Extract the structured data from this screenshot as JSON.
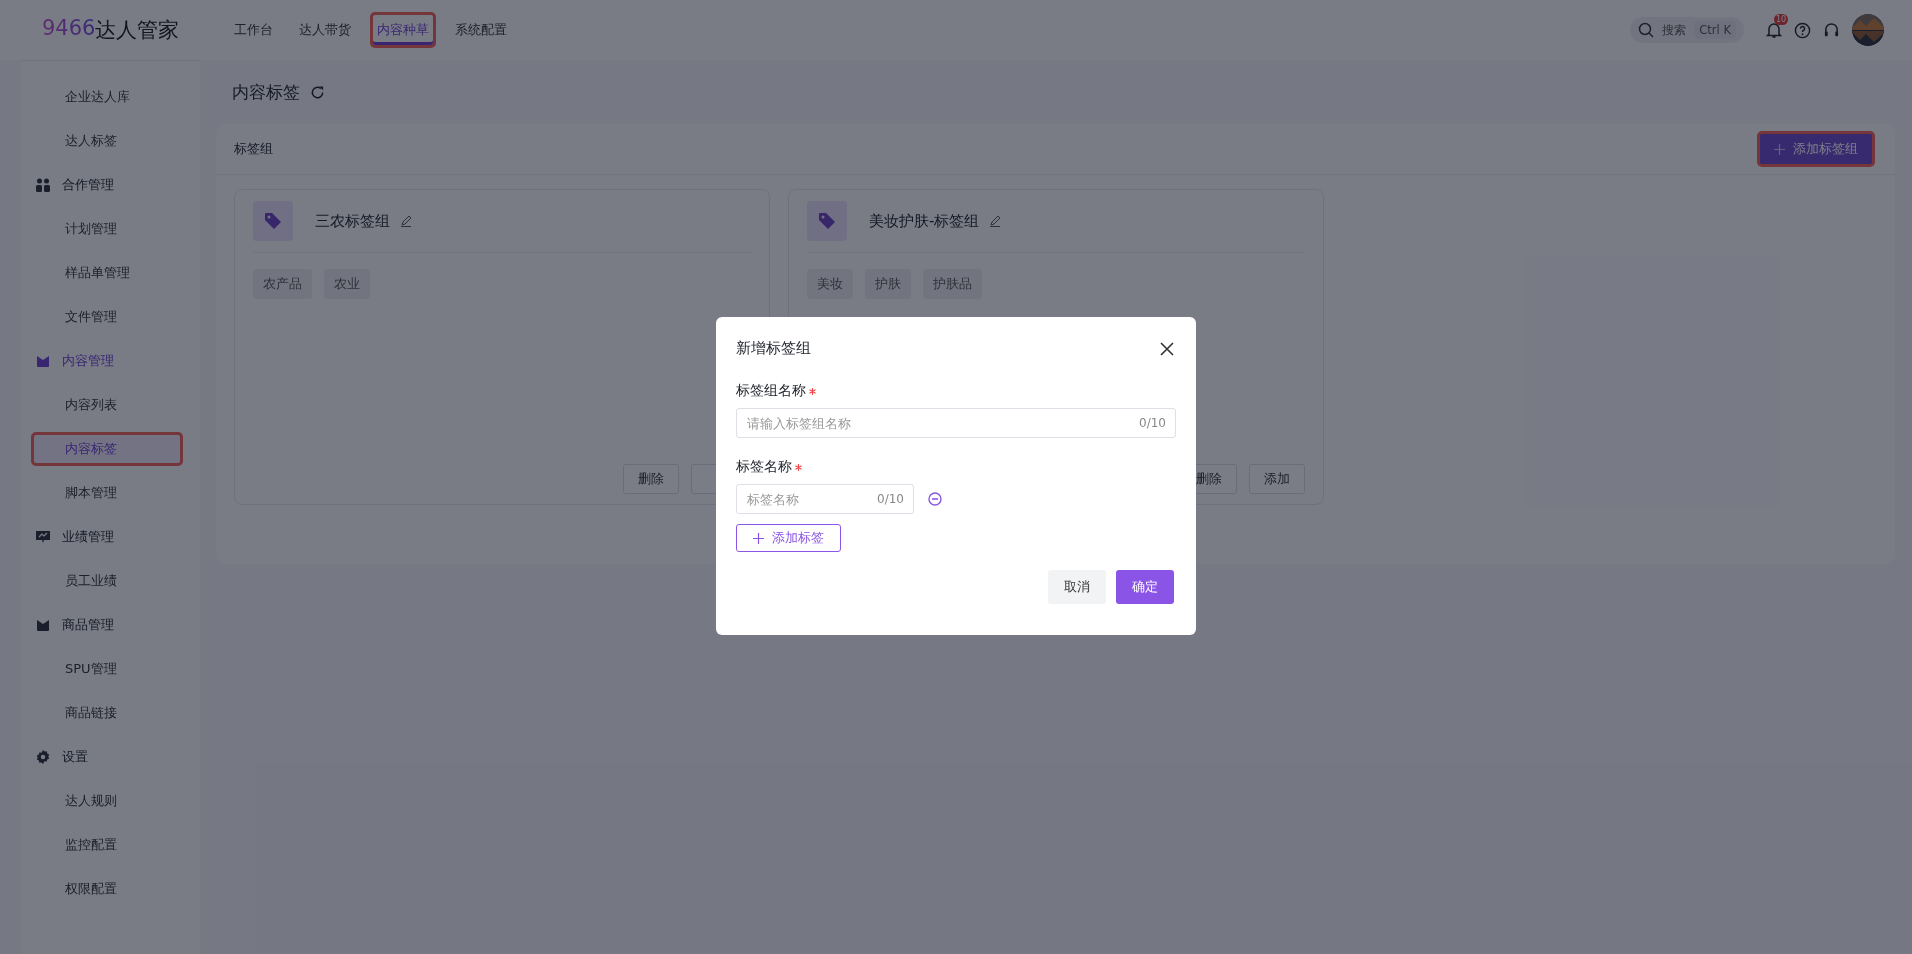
{
  "logo": {
    "digits": "9466",
    "name": "达人管家"
  },
  "top_nav": [
    {
      "label": "工作台",
      "selected": false,
      "highlighted": false
    },
    {
      "label": "达人带货",
      "selected": false,
      "highlighted": false
    },
    {
      "label": "内容种草",
      "selected": true,
      "highlighted": true
    },
    {
      "label": "系统配置",
      "selected": false,
      "highlighted": false
    }
  ],
  "search": {
    "placeholder": "搜索",
    "shortcut": "Ctrl K"
  },
  "notifications": {
    "count": "10"
  },
  "sidebar": {
    "items": [
      {
        "kind": "item",
        "label": "企业达人库",
        "selected": false,
        "highlighted": false
      },
      {
        "kind": "item",
        "label": "达人标签",
        "selected": false,
        "highlighted": false
      },
      {
        "kind": "people",
        "label": "合作管理",
        "selected": false
      },
      {
        "kind": "item",
        "label": "计划管理",
        "selected": false,
        "highlighted": false
      },
      {
        "kind": "item",
        "label": "样品单管理",
        "selected": false,
        "highlighted": false
      },
      {
        "kind": "item",
        "label": "文件管理",
        "selected": false,
        "highlighted": false
      },
      {
        "kind": "box",
        "label": "内容管理",
        "selected": true
      },
      {
        "kind": "item",
        "label": "内容列表",
        "selected": false,
        "highlighted": false
      },
      {
        "kind": "item",
        "label": "内容标签",
        "selected": true,
        "highlighted": true
      },
      {
        "kind": "item",
        "label": "脚本管理",
        "selected": false,
        "highlighted": false
      },
      {
        "kind": "chart",
        "label": "业绩管理",
        "selected": false
      },
      {
        "kind": "item",
        "label": "员工业绩",
        "selected": false,
        "highlighted": false
      },
      {
        "kind": "box",
        "label": "商品管理",
        "selected": false
      },
      {
        "kind": "item",
        "label": "SPU管理",
        "selected": false,
        "highlighted": false
      },
      {
        "kind": "item",
        "label": "商品链接",
        "selected": false,
        "highlighted": false
      },
      {
        "kind": "gear",
        "label": "设置",
        "selected": false
      },
      {
        "kind": "item",
        "label": "达人规则",
        "selected": false,
        "highlighted": false
      },
      {
        "kind": "item",
        "label": "监控配置",
        "selected": false,
        "highlighted": false
      },
      {
        "kind": "item",
        "label": "权限配置",
        "selected": false,
        "highlighted": false
      }
    ]
  },
  "page_title": "内容标签",
  "panel": {
    "title": "标签组",
    "add_button": {
      "label": "添加标签组",
      "highlighted": true
    },
    "cards": [
      {
        "name": "三农标签组",
        "tags": [
          "农产品",
          "农业"
        ],
        "buttons": [
          "删除"
        ]
      },
      {
        "name": "美妆护肤-标签组",
        "tags": [
          "美妆",
          "护肤",
          "护肤品"
        ],
        "buttons": [
          "删除",
          "添加"
        ]
      }
    ]
  },
  "dialog": {
    "title": "新增标签组",
    "group_name": {
      "label": "标签组名称",
      "required": true,
      "placeholder": "请输入标签组名称",
      "counter": "0/10"
    },
    "tag_name": {
      "label": "标签名称",
      "required": true,
      "tags": [
        {
          "placeholder": "标签名称",
          "counter": "0/10"
        }
      ]
    },
    "add_tag_button": "添加标签",
    "cancel": "取消",
    "confirm": "确定"
  }
}
